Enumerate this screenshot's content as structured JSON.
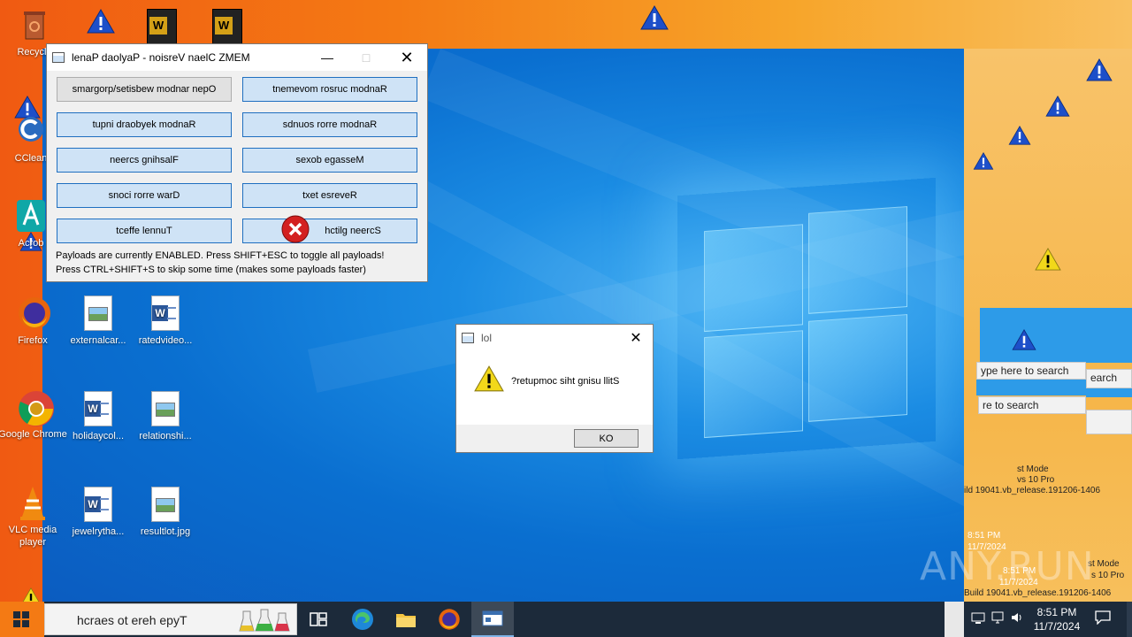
{
  "desktop": {
    "icons": [
      {
        "label": "Recycle"
      },
      {
        "label": "CClean"
      },
      {
        "label": "Acrob"
      },
      {
        "label": "Firefox"
      },
      {
        "label": "Google Chrome"
      },
      {
        "label": "VLC media player"
      },
      {
        "label": "externalcar..."
      },
      {
        "label": "ratedvideo..."
      },
      {
        "label": "holidaycol..."
      },
      {
        "label": "relationshi..."
      },
      {
        "label": "jewelrytha..."
      },
      {
        "label": "resultlot.jpg"
      }
    ]
  },
  "payload_window": {
    "title": "lenaP daolyaP - noisreV naelC ZMEM",
    "buttons": [
      "smargorp/setisbew modnar nepO",
      "tnemevom rosruc modnaR",
      "tupni draobyek modnaR",
      "sdnuos rorre modnaR",
      "neercs gnihsalF",
      "sexob egasseM",
      "snoci rorre warD",
      "txet esreveR",
      "tceffe lennuT",
      "hctilg neercS"
    ],
    "status_line1": "Payloads are currently ENABLED. Press SHIFT+ESC to toggle all payloads!",
    "status_line2": "Press CTRL+SHIFT+S to skip some time (makes some payloads faster)"
  },
  "dialog": {
    "title": "lol",
    "message": "?retupmoc siht gnisu llitS",
    "ok_label": "KO"
  },
  "glitch": {
    "search1": "ype here to search",
    "search2": "earch",
    "search3": "re to search",
    "time1": "8:51 PM",
    "date1": "11/7/2024",
    "time2": "8:51 PM",
    "date2": "11/7/2024",
    "mode1": "st Mode",
    "pro1": "vs 10 Pro",
    "build1": "ild 19041.vb_release.191206-1406",
    "mode2": "st Mode",
    "pro2": "s 10 Pro",
    "build2": "Build 19041.vb_release.191206-1406"
  },
  "taskbar": {
    "search_placeholder": "hcraes ot ereh epyT",
    "time": "8:51 PM",
    "date": "11/7/2024"
  },
  "watermark": "ANY.RUN",
  "colors": {
    "accent": "#1f6fc0",
    "button_fill": "#cfe3f6",
    "desktop_blue": "#0a6fd0",
    "orange_glitch": "#f47a14"
  }
}
